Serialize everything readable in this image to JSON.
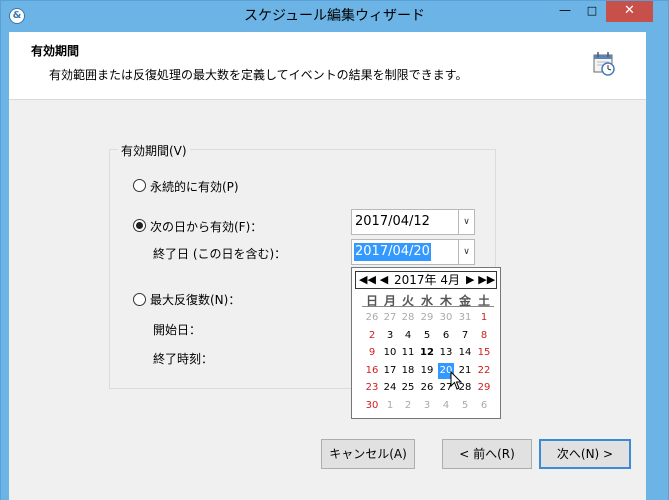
{
  "window": {
    "title": "スケジュール編集ウィザード",
    "app_icon_glyph": "&",
    "min_glyph": "—",
    "max_glyph": "□",
    "close_glyph": "✕"
  },
  "header": {
    "title": "有効期間",
    "description": "有効範囲または反復処理の最大数を定義してイベントの結果を制限できます。",
    "icon": "calendar-clock-icon"
  },
  "group": {
    "legend": "有効期間(V)",
    "option_forever": "永続的に有効(P)",
    "option_from": "次の日から有効(F)：",
    "end_date_label": "終了日 (この日を含む)：",
    "option_max_repeat": "最大反復数(N)：",
    "start_date_label": "開始日：",
    "end_time_label": "終了時刻：",
    "selected_option": "option_from"
  },
  "date_from": {
    "value": "2017/04/12",
    "dropdown_glyph": "∨"
  },
  "date_end": {
    "value": "2017/04/20",
    "dropdown_glyph": "∨"
  },
  "calendar": {
    "month_label": "2017年 4月",
    "prev_glyph": "◀◀ ◀",
    "next_glyph": "▶ ▶▶",
    "weekdays": [
      "日",
      "月",
      "火",
      "水",
      "木",
      "金",
      "土"
    ],
    "weeks": [
      [
        "26",
        "27",
        "28",
        "29",
        "30",
        "31",
        "1"
      ],
      [
        "2",
        "3",
        "4",
        "5",
        "6",
        "7",
        "8"
      ],
      [
        "9",
        "10",
        "11",
        "12",
        "13",
        "14",
        "15"
      ],
      [
        "16",
        "17",
        "18",
        "19",
        "20",
        "21",
        "22"
      ],
      [
        "23",
        "24",
        "25",
        "26",
        "27",
        "28",
        "29"
      ],
      [
        "30",
        "1",
        "2",
        "3",
        "4",
        "5",
        "6"
      ]
    ],
    "today": "12",
    "selected": "20"
  },
  "buttons": {
    "cancel": "キャンセル(A)",
    "back": "< 前へ(R)",
    "next": "次へ(N) >"
  },
  "colors": {
    "titlebar": "#6cb4e6",
    "close": "#c7504b",
    "selection": "#3399ff",
    "weekend": "#d02020"
  }
}
